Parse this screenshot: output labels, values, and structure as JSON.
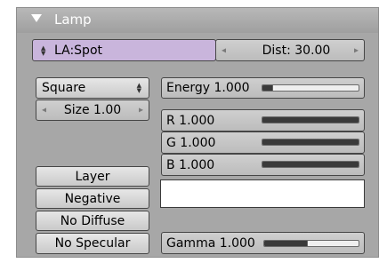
{
  "panel": {
    "title": "Lamp",
    "icons": {
      "collapse": "triangle-down-icon"
    }
  },
  "lamp_type": {
    "label": "LA:Spot"
  },
  "dist": {
    "label": "Dist: 30.00",
    "value": 30.0
  },
  "shape_select": {
    "value": "Square",
    "options_visible": [
      "Square"
    ]
  },
  "size": {
    "label": "Size 1.00",
    "value": 1.0
  },
  "energy": {
    "label": "Energy 1.000",
    "value": 1.0,
    "fill": 0.1
  },
  "color": {
    "r": {
      "label": "R 1.000",
      "value": 1.0,
      "fill": 1.0
    },
    "g": {
      "label": "G 1.000",
      "value": 1.0,
      "fill": 1.0
    },
    "b": {
      "label": "B 1.000",
      "value": 1.0,
      "fill": 1.0
    },
    "swatch_color": "#ffffff"
  },
  "toggles": {
    "layer": "Layer",
    "negative": "Negative",
    "no_diffuse": "No Diffuse",
    "no_specular": "No Specular"
  },
  "gamma": {
    "label": "Gamma 1.000",
    "value": 1.0,
    "fill": 0.45
  },
  "colors": {
    "panel_bg": "#a7a7a7",
    "lamp_type_bg": "#c9b5dc",
    "slider_fill": "#3a3a3a"
  }
}
